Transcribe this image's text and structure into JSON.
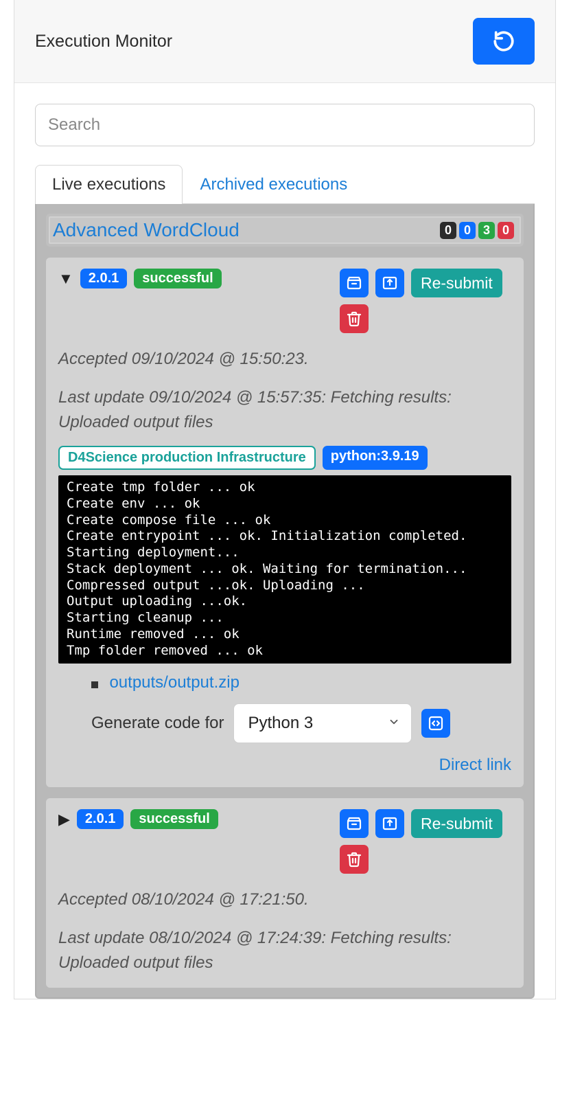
{
  "header": {
    "title": "Execution Monitor"
  },
  "search": {
    "placeholder": "Search"
  },
  "tabs": {
    "live": "Live executions",
    "archived": "Archived executions"
  },
  "group": {
    "title": "Advanced WordCloud",
    "counters": {
      "dark": "0",
      "blue": "0",
      "green": "3",
      "red": "0"
    }
  },
  "actions": {
    "resubmit": "Re-submit"
  },
  "exec1": {
    "version": "2.0.1",
    "status": "successful",
    "accepted": "Accepted 09/10/2024 @ 15:50:23.",
    "last_update": "Last update 09/10/2024 @ 15:57:35:  Fetching results: Uploaded output files",
    "infra": "D4Science production Infrastructure",
    "runtime": "python:3.9.19",
    "console": "Create tmp folder ... ok\nCreate env ... ok\nCreate compose file ... ok\nCreate entrypoint ... ok. Initialization completed. Starting deployment...\nStack deployment ... ok. Waiting for termination...\nCompressed output ...ok. Uploading ...\nOutput uploading ...ok.\nStarting cleanup ...\nRuntime removed ... ok\nTmp folder removed ... ok",
    "output_file": "outputs/output.zip",
    "gen_label": "Generate code for",
    "gen_selected": "Python 3",
    "direct_link": "Direct link"
  },
  "exec2": {
    "version": "2.0.1",
    "status": "successful",
    "accepted": "Accepted 08/10/2024 @ 17:21:50.",
    "last_update": "Last update 08/10/2024 @ 17:24:39:  Fetching results: Uploaded output files"
  }
}
